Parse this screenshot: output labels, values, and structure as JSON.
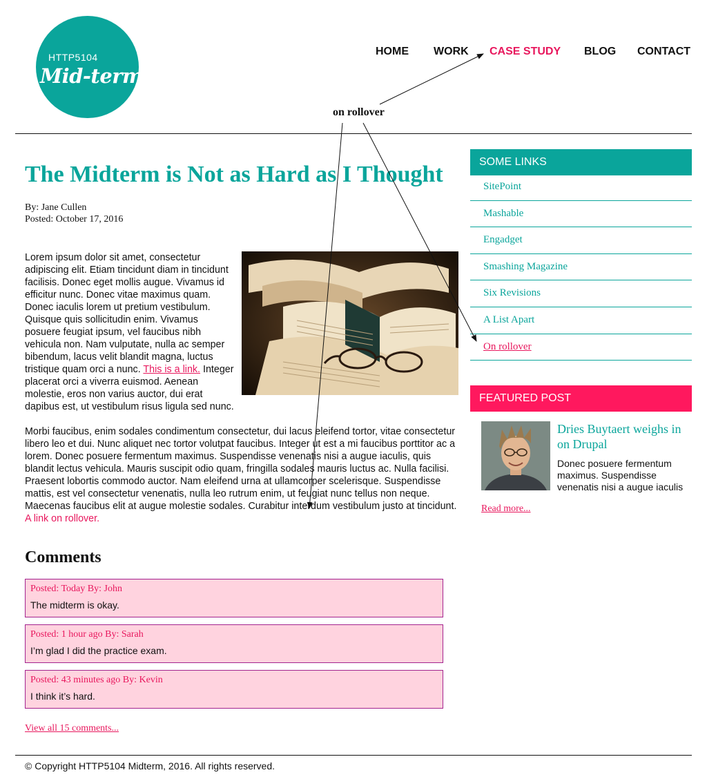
{
  "logo": {
    "small": "HTTP5104",
    "big": "Mid-term"
  },
  "nav": [
    {
      "label": "HOME"
    },
    {
      "label": "WORK"
    },
    {
      "label": "CASE STUDY"
    },
    {
      "label": "BLOG"
    },
    {
      "label": "CONTACT"
    }
  ],
  "annotation": {
    "label": "on rollover"
  },
  "article": {
    "title": "The Midterm is Not as Hard as I Thought",
    "byline": "By: Jane Cullen",
    "posted": "Posted:  October 17, 2016",
    "p1_before": "Lorem ipsum dolor sit amet, consectetur adipiscing elit. Etiam tincidunt diam in tincidunt facilisis. Donec eget mollis augue. Vivamus id efficitur nunc. Donec vitae maximus quam. Donec iaculis lorem ut pretium vestibulum. Quisque quis sollicitudin enim. Vivamus posuere feugiat ipsum, vel faucibus nibh vehicula non. Nam vulputate, nulla ac semper bibendum, lacus velit blandit magna, luctus tristique quam orci a nunc. ",
    "p1_link": "This is a link.",
    "p1_after": " Integer placerat orci a viverra euismod. Aenean molestie, eros non varius auctor, dui erat dapibus est, ut vestibulum risus ligula sed nunc.",
    "p2_before": "Morbi faucibus, enim sodales condimentum consectetur, dui lacus eleifend tortor, vitae consectetur libero leo et dui. Nunc aliquet nec tortor volutpat faucibus. Integer ut est a mi faucibus porttitor ac a lorem. Donec posuere fermentum maximus. Suspendisse venenatis nisi a augue iaculis, quis blandit lectus vehicula. Mauris suscipit odio quam, fringilla sodales mauris luctus ac. Nulla facilisi. Praesent lobortis commodo auctor. Nam eleifend urna at ullamcorper scelerisque. Suspendisse mattis, est vel consectetur venenatis, nulla leo rutrum enim, ut feugiat nunc tellus non neque. Maecenas faucibus elit at augue molestie sodales. Curabitur interdum vestibulum justo at tincidunt. ",
    "p2_link": "A link on rollover."
  },
  "comments": {
    "heading": "Comments",
    "items": [
      {
        "meta": "Posted: Today  By: John",
        "text": "The midterm is okay."
      },
      {
        "meta": "Posted: 1 hour ago  By: Sarah",
        "text": "I’m glad I did the practice exam."
      },
      {
        "meta": "Posted: 43 minutes ago  By: Kevin",
        "text": "I think it’s hard."
      }
    ],
    "view_all": "View all 15 comments..."
  },
  "sidebar": {
    "links_heading": "SOME LINKS",
    "links": [
      {
        "label": "SitePoint"
      },
      {
        "label": "Mashable"
      },
      {
        "label": "Engadget"
      },
      {
        "label": "Smashing Magazine"
      },
      {
        "label": "Six Revisions"
      },
      {
        "label": "A List Apart"
      },
      {
        "label": "On rollover"
      }
    ],
    "featured_heading": "FEATURED POST",
    "featured_title": "Dries Buytaert weighs in on Drupal",
    "featured_text": "Donec posuere fermentum maximus. Suspendisse venenatis nisi a augue iaculis",
    "read_more": "Read more..."
  },
  "footer": {
    "text": "© Copyright HTTP5104 Midterm, 2016. All rights reserved."
  },
  "colors": {
    "teal": "#0aa59b",
    "pink": "#e8175d",
    "featured_pink": "#ff185e",
    "comment_bg": "#ffd3df",
    "comment_border": "#a3238e"
  }
}
